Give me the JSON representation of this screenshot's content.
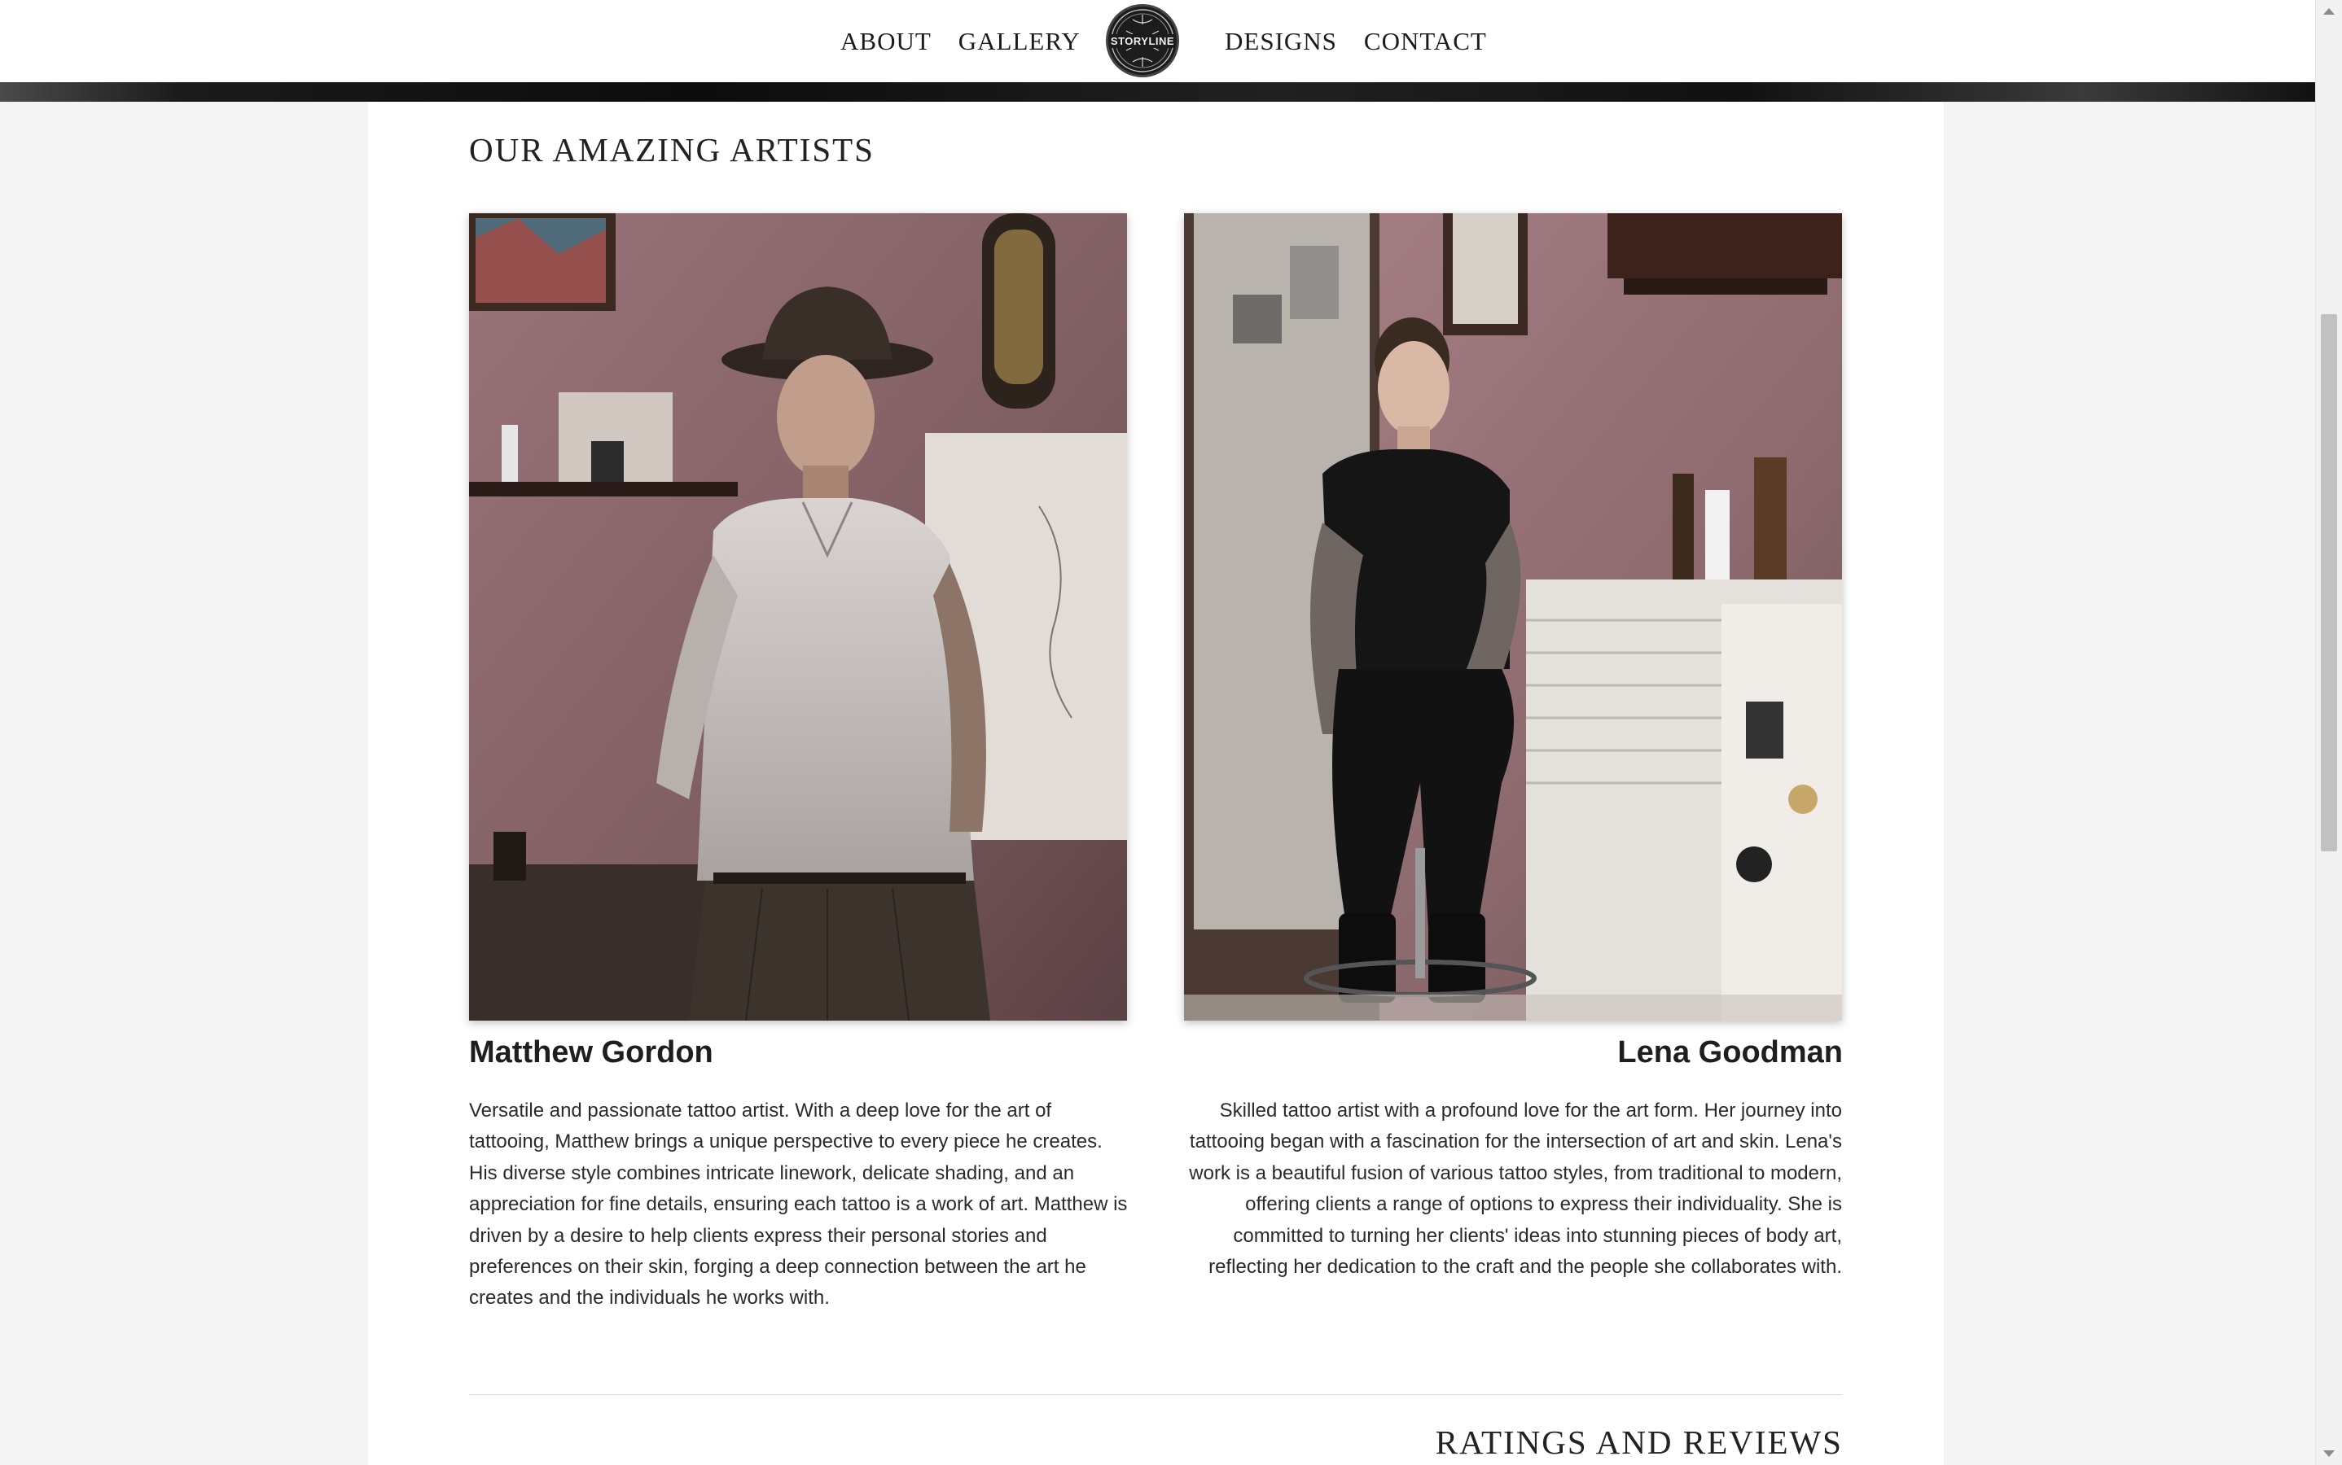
{
  "nav": {
    "left": [
      "ABOUT",
      "GALLERY"
    ],
    "right": [
      "DESIGNS",
      "CONTACT"
    ],
    "logo_text": "STORYLINE"
  },
  "section": {
    "title": "OUR AMAZING ARTISTS"
  },
  "artists": [
    {
      "name": "Matthew Gordon",
      "bio": "Versatile and passionate tattoo artist. With a deep love for the art of tattooing, Matthew brings a unique perspective to every piece he creates. His diverse style combines intricate linework, delicate shading, and an appreciation for fine details, ensuring each tattoo is a work of art. Matthew is driven by a desire to help clients express their personal stories and preferences on their skin, forging a deep connection between the art he creates and the individuals he works with."
    },
    {
      "name": "Lena Goodman",
      "bio": "Skilled tattoo artist with a profound love for the art form. Her journey into tattooing began with a fascination for the intersection of art and skin. Lena's work is a beautiful fusion of various tattoo styles, from traditional to modern, offering clients a range of options to express their individuality. She is committed to turning her clients' ideas into stunning pieces of body art, reflecting her dedication to the craft and the people she collaborates with."
    }
  ],
  "ratings": {
    "title": "RATINGS AND REVIEWS"
  },
  "colors": {
    "page_bg": "#f4f4f4",
    "content_bg": "#ffffff",
    "text": "#222222",
    "wall_pink": "#8c6a6e"
  }
}
